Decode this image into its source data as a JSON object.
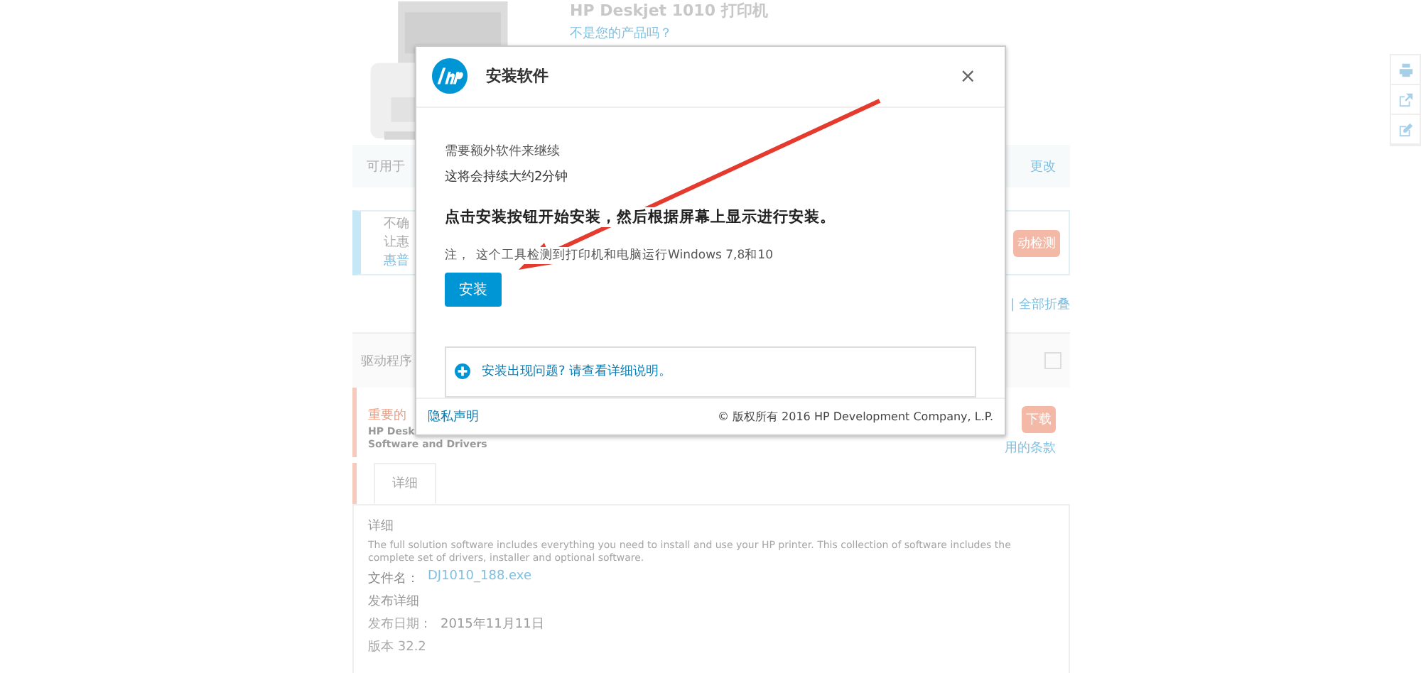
{
  "page": {
    "product_title": "HP Deskjet 1010 打印机",
    "not_your_product": "不是您的产品吗？",
    "available_for": "可用于",
    "change": "更改",
    "notice": {
      "lines": [
        "不确",
        "让惠",
        "惠普"
      ],
      "button": "动检测"
    },
    "expand_collapse": "| 全部折叠",
    "drivers_header": "驱动程序",
    "driver": {
      "badge": "重要的",
      "name": "HP Desk",
      "type": "Software and Drivers",
      "download": "下载",
      "terms_link": "用的条款"
    },
    "tabs": [
      {
        "label": "详细",
        "selected": true
      }
    ],
    "details": {
      "heading": "详细",
      "description": "The full solution software includes everything you need to install and use your HP printer. This collection of software includes the complete set of drivers, installer and optional software.",
      "file_label": "文件名：",
      "file_name": "DJ1010_188.exe",
      "release_heading": "发布详细",
      "release_date_label": "发布日期：",
      "release_date": "2015年11月11日",
      "version": "版本 32.2"
    }
  },
  "dialog": {
    "title": "安装软件",
    "close": "×",
    "line_1": "需要额外软件来继续",
    "line_2": "这将会持续大约2分钟",
    "instruction": "点击安装按钮开始安装，然后根据屏幕上显示进行安装。",
    "note_label": "注，",
    "note": "这个工具检测到打印机和电脑运行Windows 7,8和10",
    "install_button": "安装",
    "help": {
      "text": "安装出现问题? 请查看详细说明。",
      "expanded": false
    },
    "privacy_link": "隐私声明",
    "copyright": "© 版权所有 2016 HP Development Company, L.P."
  }
}
